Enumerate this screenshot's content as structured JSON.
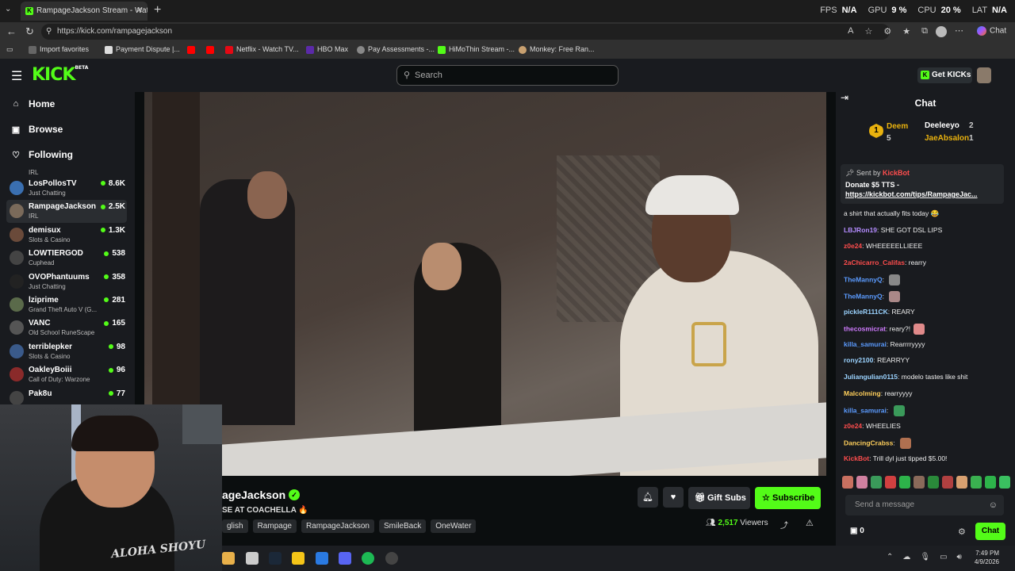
{
  "browser": {
    "tab_title": "RampageJackson Stream - Watch",
    "url": "https://kick.com/rampagejackson",
    "perf": [
      {
        "label": "FPS",
        "value": "N/A"
      },
      {
        "label": "GPU",
        "value": "9 %"
      },
      {
        "label": "CPU",
        "value": "20 %"
      },
      {
        "label": "LAT",
        "value": "N/A"
      }
    ],
    "bookmarks": [
      "Import favorites",
      "Payment Dispute |...",
      "",
      "",
      "Netflix - Watch TV...",
      "HBO Max",
      "Pay Assessments -...",
      "HiMoThin Stream -...",
      "Monkey: Free Ran..."
    ],
    "copilot_label": "Chat"
  },
  "header": {
    "logo": "KICK",
    "logo_badge": "BETA",
    "search_placeholder": "Search",
    "get_kicks": "Get KICKs"
  },
  "sidebar": {
    "nav": [
      "Home",
      "Browse",
      "Following"
    ],
    "partial_top_category": "IRL",
    "channels": [
      {
        "name": "LosPollosTV",
        "category": "Just Chatting",
        "viewers": "8.6K",
        "color": "#3a6fb0"
      },
      {
        "name": "RampageJackson",
        "category": "IRL",
        "viewers": "2.5K",
        "color": "#7a6a5a",
        "active": true
      },
      {
        "name": "demisux",
        "category": "Slots & Casino",
        "viewers": "1.3K",
        "color": "#6a4a3a"
      },
      {
        "name": "LOWTIERGOD",
        "category": "Cuphead",
        "viewers": "538",
        "color": "#444"
      },
      {
        "name": "OVOPhantuums",
        "category": "Just Chatting",
        "viewers": "358",
        "color": "#222"
      },
      {
        "name": "lziprime",
        "category": "Grand Theft Auto V (G...",
        "viewers": "281",
        "color": "#5a6a4a"
      },
      {
        "name": "VANC",
        "category": "Old School RuneScape",
        "viewers": "165",
        "color": "#555"
      },
      {
        "name": "terriblepker",
        "category": "Slots & Casino",
        "viewers": "98",
        "color": "#3a5a8a"
      },
      {
        "name": "OakleyBoiii",
        "category": "Call of Duty: Warzone",
        "viewers": "96",
        "color": "#8a2a2a"
      },
      {
        "name": "Pak8u",
        "category": "",
        "viewers": "77",
        "color": "#444"
      }
    ]
  },
  "stream": {
    "streamer_visible": "ageJackson",
    "title_visible": "SE AT COACHELLA 🔥",
    "tags": [
      "glish",
      "Rampage",
      "RampageJackson",
      "SmileBack",
      "OneWater"
    ],
    "viewers": "2,517",
    "viewers_label": "Viewers",
    "gift_subs": "Gift Subs",
    "subscribe": "Subscribe",
    "webcam_shirt_text": "ALOHA SHOYU"
  },
  "chat": {
    "title": "Chat",
    "leaderboard": [
      {
        "name": "Deem",
        "count": "5",
        "color": "#e9b20e"
      },
      {
        "name": "Deeleeyo",
        "count": "2",
        "color": "#ffffff"
      },
      {
        "name": "JaeAbsalon",
        "count": "1",
        "color": "#e9b20e"
      }
    ],
    "pinned": {
      "sent_by": "Sent by",
      "bot": "KickBot",
      "line1": "Donate $5 TTS -",
      "link": "https://kickbot.com/tips/RampageJac..."
    },
    "messages": [
      {
        "user": "",
        "text": "a shirt that actually fits today 😂",
        "color": "#ffffff"
      },
      {
        "user": "LBJRon19",
        "text": "SHE GOT DSL LIPS",
        "color": "#b48cff"
      },
      {
        "user": "z0e24",
        "text": "WHEEEEELLIEEE",
        "color": "#ff4d4d"
      },
      {
        "user": "2aChicarro_Califas",
        "text": "rearry",
        "color": "#ff4d4d"
      },
      {
        "user": "TheMannyQ",
        "text": "",
        "color": "#5b9bff",
        "emote": "#888"
      },
      {
        "user": "TheMannyQ",
        "text": "",
        "color": "#5b9bff",
        "emote": "#a88"
      },
      {
        "user": "pickleR111CK",
        "text": "REARY",
        "color": "#9bd3ff"
      },
      {
        "user": "thecosmicrat",
        "text": "reary?!",
        "color": "#d07bff",
        "emote": "#e08a8a"
      },
      {
        "user": "killa_samurai",
        "text": "Rearrrryyyy",
        "color": "#5b9bff"
      },
      {
        "user": "rony2100",
        "text": "REARRYY",
        "color": "#9bd3ff"
      },
      {
        "user": "Juliangulian0115",
        "text": "modelo tastes like shit",
        "color": "#9bd3ff"
      },
      {
        "user": "Malcolming",
        "text": "rearryyyy",
        "color": "#ffcf5b"
      },
      {
        "user": "killa_samurai",
        "text": "",
        "color": "#5b9bff",
        "emote": "#3a9a5a"
      },
      {
        "user": "z0e24",
        "text": "WHEELIES",
        "color": "#ff4d4d"
      },
      {
        "user": "DancingCrabss",
        "text": "",
        "color": "#ffcf5b",
        "emote": "#b07050"
      },
      {
        "user": "KickBot",
        "text": "Trill dyl just tipped $5.00!",
        "color": "#ff4d4d"
      }
    ],
    "send_placeholder": "Send a message",
    "footer_count": "0",
    "chat_button": "Chat"
  },
  "taskbar": {
    "time": "7:49 PM",
    "date": "4/9/2026"
  }
}
